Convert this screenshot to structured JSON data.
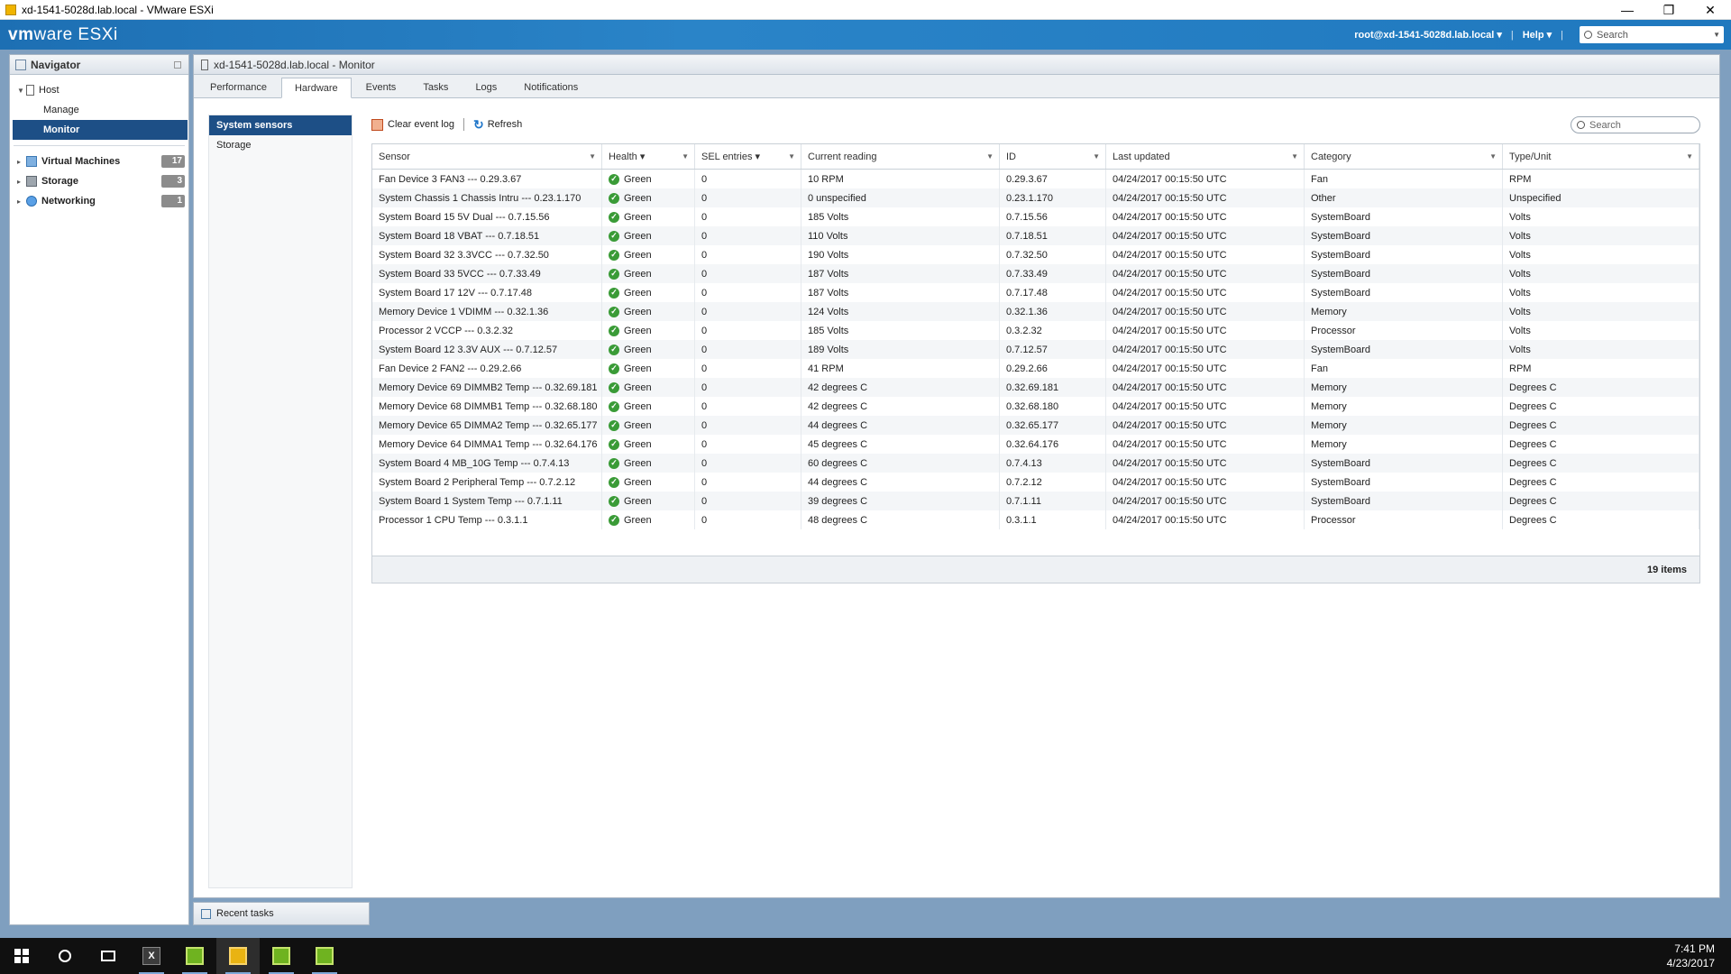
{
  "window": {
    "title": "xd-1541-5028d.lab.local - VMware ESXi"
  },
  "header": {
    "logo_vm": "vm",
    "logo_ware": "ware",
    "logo_product": " ESXi",
    "user": "root@xd-1541-5028d.lab.local",
    "help": "Help",
    "search_placeholder": "Search"
  },
  "navigator": {
    "title": "Navigator",
    "host": "Host",
    "manage": "Manage",
    "monitor": "Monitor",
    "items": [
      {
        "label": "Virtual Machines",
        "count": "17"
      },
      {
        "label": "Storage",
        "count": "3"
      },
      {
        "label": "Networking",
        "count": "1"
      }
    ]
  },
  "main": {
    "title": "xd-1541-5028d.lab.local - Monitor",
    "tabs": [
      "Performance",
      "Hardware",
      "Events",
      "Tasks",
      "Logs",
      "Notifications"
    ],
    "subnav": [
      "System sensors",
      "Storage"
    ],
    "toolbar": {
      "clear": "Clear event log",
      "refresh": "Refresh",
      "search_placeholder": "Search"
    },
    "columns": [
      "Sensor",
      "Health ▾",
      "SEL entries ▾",
      "Current reading",
      "ID",
      "Last updated",
      "Category",
      "Type/Unit"
    ],
    "rows": [
      [
        "Fan Device 3 FAN3 --- 0.29.3.67",
        "Green",
        "0",
        "10 RPM",
        "0.29.3.67",
        "04/24/2017 00:15:50 UTC",
        "Fan",
        "RPM"
      ],
      [
        "System Chassis 1 Chassis Intru --- 0.23.1.170",
        "Green",
        "0",
        "0 unspecified",
        "0.23.1.170",
        "04/24/2017 00:15:50 UTC",
        "Other",
        "Unspecified"
      ],
      [
        "System Board 15 5V Dual --- 0.7.15.56",
        "Green",
        "0",
        "185 Volts",
        "0.7.15.56",
        "04/24/2017 00:15:50 UTC",
        "SystemBoard",
        "Volts"
      ],
      [
        "System Board 18 VBAT --- 0.7.18.51",
        "Green",
        "0",
        "110 Volts",
        "0.7.18.51",
        "04/24/2017 00:15:50 UTC",
        "SystemBoard",
        "Volts"
      ],
      [
        "System Board 32 3.3VCC --- 0.7.32.50",
        "Green",
        "0",
        "190 Volts",
        "0.7.32.50",
        "04/24/2017 00:15:50 UTC",
        "SystemBoard",
        "Volts"
      ],
      [
        "System Board 33 5VCC --- 0.7.33.49",
        "Green",
        "0",
        "187 Volts",
        "0.7.33.49",
        "04/24/2017 00:15:50 UTC",
        "SystemBoard",
        "Volts"
      ],
      [
        "System Board 17 12V --- 0.7.17.48",
        "Green",
        "0",
        "187 Volts",
        "0.7.17.48",
        "04/24/2017 00:15:50 UTC",
        "SystemBoard",
        "Volts"
      ],
      [
        "Memory Device 1 VDIMM --- 0.32.1.36",
        "Green",
        "0",
        "124 Volts",
        "0.32.1.36",
        "04/24/2017 00:15:50 UTC",
        "Memory",
        "Volts"
      ],
      [
        "Processor 2 VCCP --- 0.3.2.32",
        "Green",
        "0",
        "185 Volts",
        "0.3.2.32",
        "04/24/2017 00:15:50 UTC",
        "Processor",
        "Volts"
      ],
      [
        "System Board 12 3.3V AUX --- 0.7.12.57",
        "Green",
        "0",
        "189 Volts",
        "0.7.12.57",
        "04/24/2017 00:15:50 UTC",
        "SystemBoard",
        "Volts"
      ],
      [
        "Fan Device 2 FAN2 --- 0.29.2.66",
        "Green",
        "0",
        "41 RPM",
        "0.29.2.66",
        "04/24/2017 00:15:50 UTC",
        "Fan",
        "RPM"
      ],
      [
        "Memory Device 69 DIMMB2 Temp --- 0.32.69.181",
        "Green",
        "0",
        "42 degrees C",
        "0.32.69.181",
        "04/24/2017 00:15:50 UTC",
        "Memory",
        "Degrees C"
      ],
      [
        "Memory Device 68 DIMMB1 Temp --- 0.32.68.180",
        "Green",
        "0",
        "42 degrees C",
        "0.32.68.180",
        "04/24/2017 00:15:50 UTC",
        "Memory",
        "Degrees C"
      ],
      [
        "Memory Device 65 DIMMA2 Temp --- 0.32.65.177",
        "Green",
        "0",
        "44 degrees C",
        "0.32.65.177",
        "04/24/2017 00:15:50 UTC",
        "Memory",
        "Degrees C"
      ],
      [
        "Memory Device 64 DIMMA1 Temp --- 0.32.64.176",
        "Green",
        "0",
        "45 degrees C",
        "0.32.64.176",
        "04/24/2017 00:15:50 UTC",
        "Memory",
        "Degrees C"
      ],
      [
        "System Board 4 MB_10G Temp --- 0.7.4.13",
        "Green",
        "0",
        "60 degrees C",
        "0.7.4.13",
        "04/24/2017 00:15:50 UTC",
        "SystemBoard",
        "Degrees C"
      ],
      [
        "System Board 2 Peripheral Temp --- 0.7.2.12",
        "Green",
        "0",
        "44 degrees C",
        "0.7.2.12",
        "04/24/2017 00:15:50 UTC",
        "SystemBoard",
        "Degrees C"
      ],
      [
        "System Board 1 System Temp --- 0.7.1.11",
        "Green",
        "0",
        "39 degrees C",
        "0.7.1.11",
        "04/24/2017 00:15:50 UTC",
        "SystemBoard",
        "Degrees C"
      ],
      [
        "Processor 1 CPU Temp --- 0.3.1.1",
        "Green",
        "0",
        "48 degrees C",
        "0.3.1.1",
        "04/24/2017 00:15:50 UTC",
        "Processor",
        "Degrees C"
      ]
    ],
    "footer_count": "19 items"
  },
  "recent_tasks": "Recent tasks",
  "taskbar": {
    "time": "7:41 PM",
    "date": "4/23/2017"
  },
  "icons": [
    "windows-logo-icon",
    "cortana-icon",
    "task-view-icon",
    "excel-icon",
    "vmware-icon",
    "refresh-icon",
    "search-icon",
    "health-ok-icon"
  ],
  "colors": {
    "header_blue": "#1f78be",
    "selected_nav": "#1d4f86",
    "health_green": "#3a9b37"
  }
}
